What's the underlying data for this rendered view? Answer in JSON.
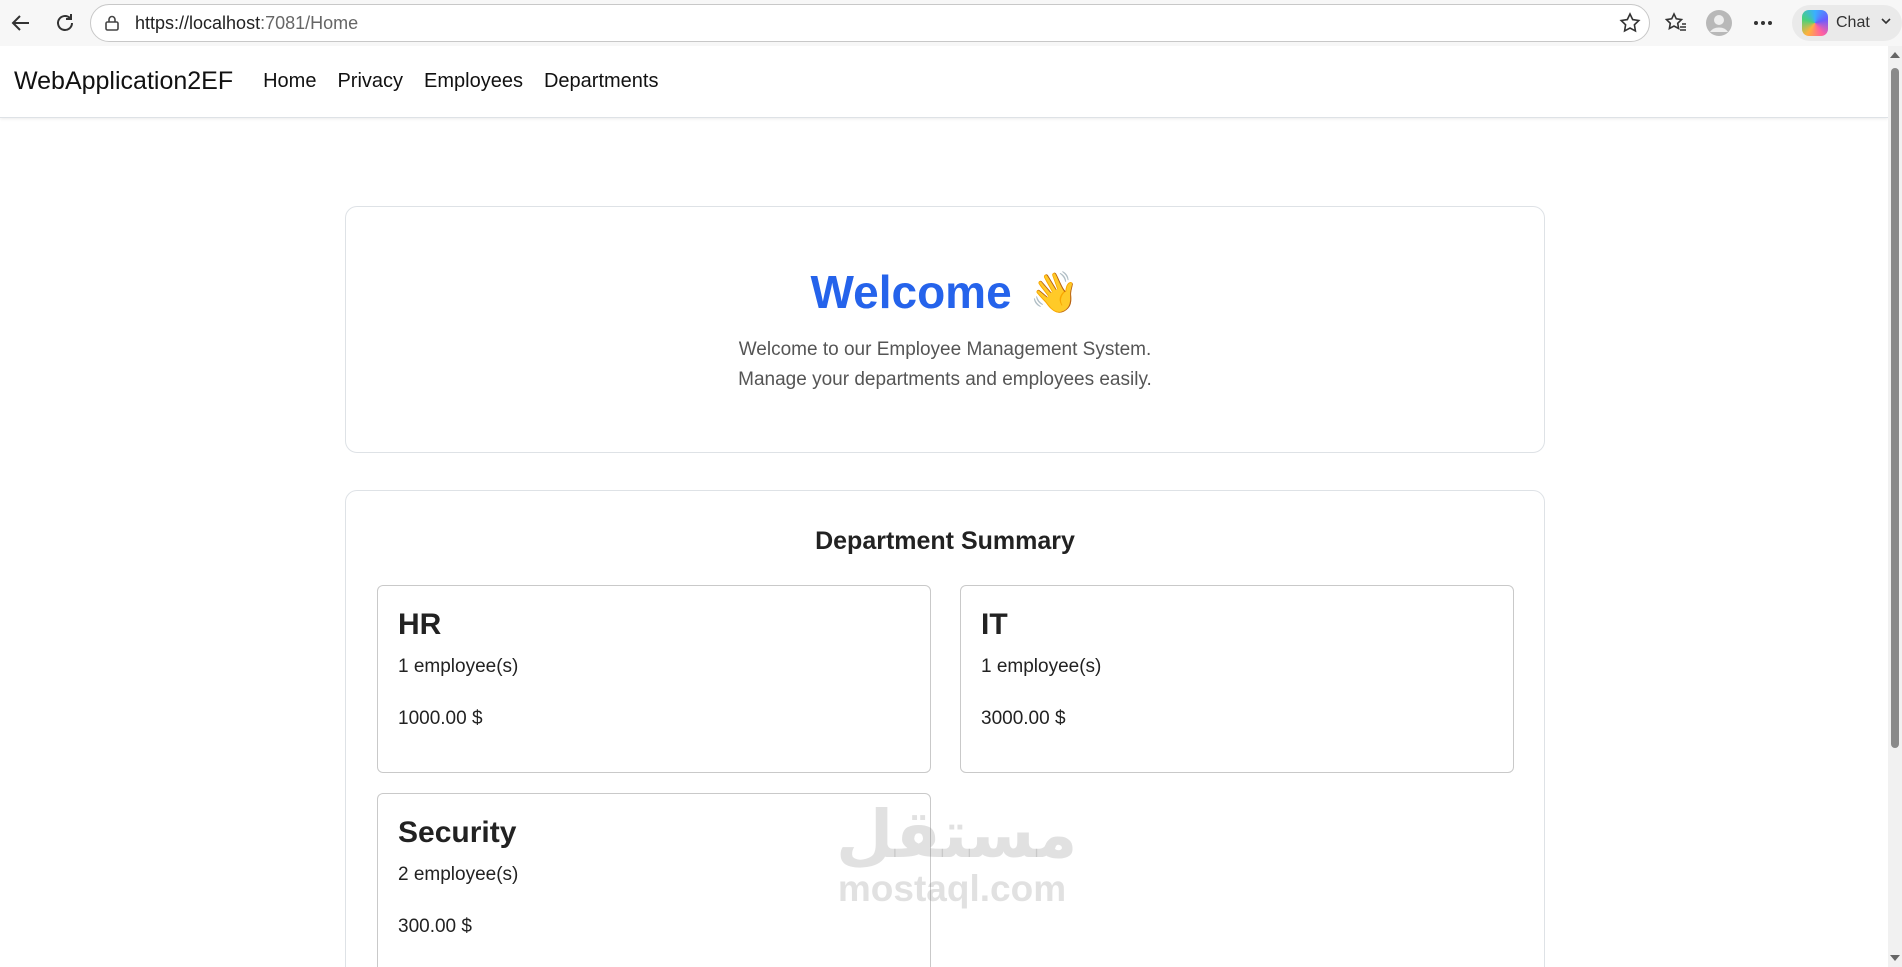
{
  "browser": {
    "url_host": "https://localhost",
    "url_path": ":7081/Home",
    "chat_label": "Chat"
  },
  "navbar": {
    "brand": "WebApplication2EF",
    "links": [
      "Home",
      "Privacy",
      "Employees",
      "Departments"
    ]
  },
  "welcome": {
    "title": "Welcome",
    "emoji": "👋",
    "line1": "Welcome to our Employee Management System.",
    "line2": "Manage your departments and employees easily."
  },
  "summary": {
    "title": "Department Summary",
    "departments": [
      {
        "name": "HR",
        "count": "1 employee(s)",
        "salary": "1000.00 $"
      },
      {
        "name": "IT",
        "count": "1 employee(s)",
        "salary": "3000.00 $"
      },
      {
        "name": "Security",
        "count": "2 employee(s)",
        "salary": "300.00 $"
      }
    ]
  },
  "watermark": {
    "arabic": "مستقل",
    "latin": "mostaql.com"
  },
  "colors": {
    "welcome_title": "#2563eb",
    "border": "#dee2e6"
  }
}
